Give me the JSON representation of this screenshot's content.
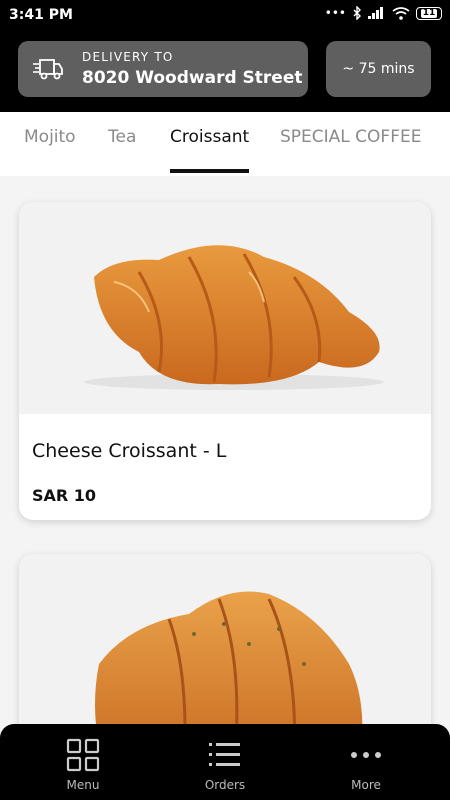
{
  "status_bar": {
    "time": "3:41 PM",
    "battery": "11"
  },
  "header": {
    "delivery_label": "DELIVERY TO",
    "delivery_address": "8020 Woodward Street ...",
    "eta": "~ 75 mins"
  },
  "tabs": [
    {
      "label": "Mojito",
      "active": false
    },
    {
      "label": "Tea",
      "active": false
    },
    {
      "label": "Croissant",
      "active": true
    },
    {
      "label": "SPECIAL COFFEE",
      "active": false
    }
  ],
  "products": [
    {
      "name": "Cheese Croissant - L",
      "price": "SAR 10"
    }
  ],
  "bottom_nav": {
    "menu": "Menu",
    "orders": "Orders",
    "more": "More"
  },
  "colors": {
    "header_bg": "#000000",
    "pill_bg": "#5f5f5f",
    "accent": "#111111"
  }
}
